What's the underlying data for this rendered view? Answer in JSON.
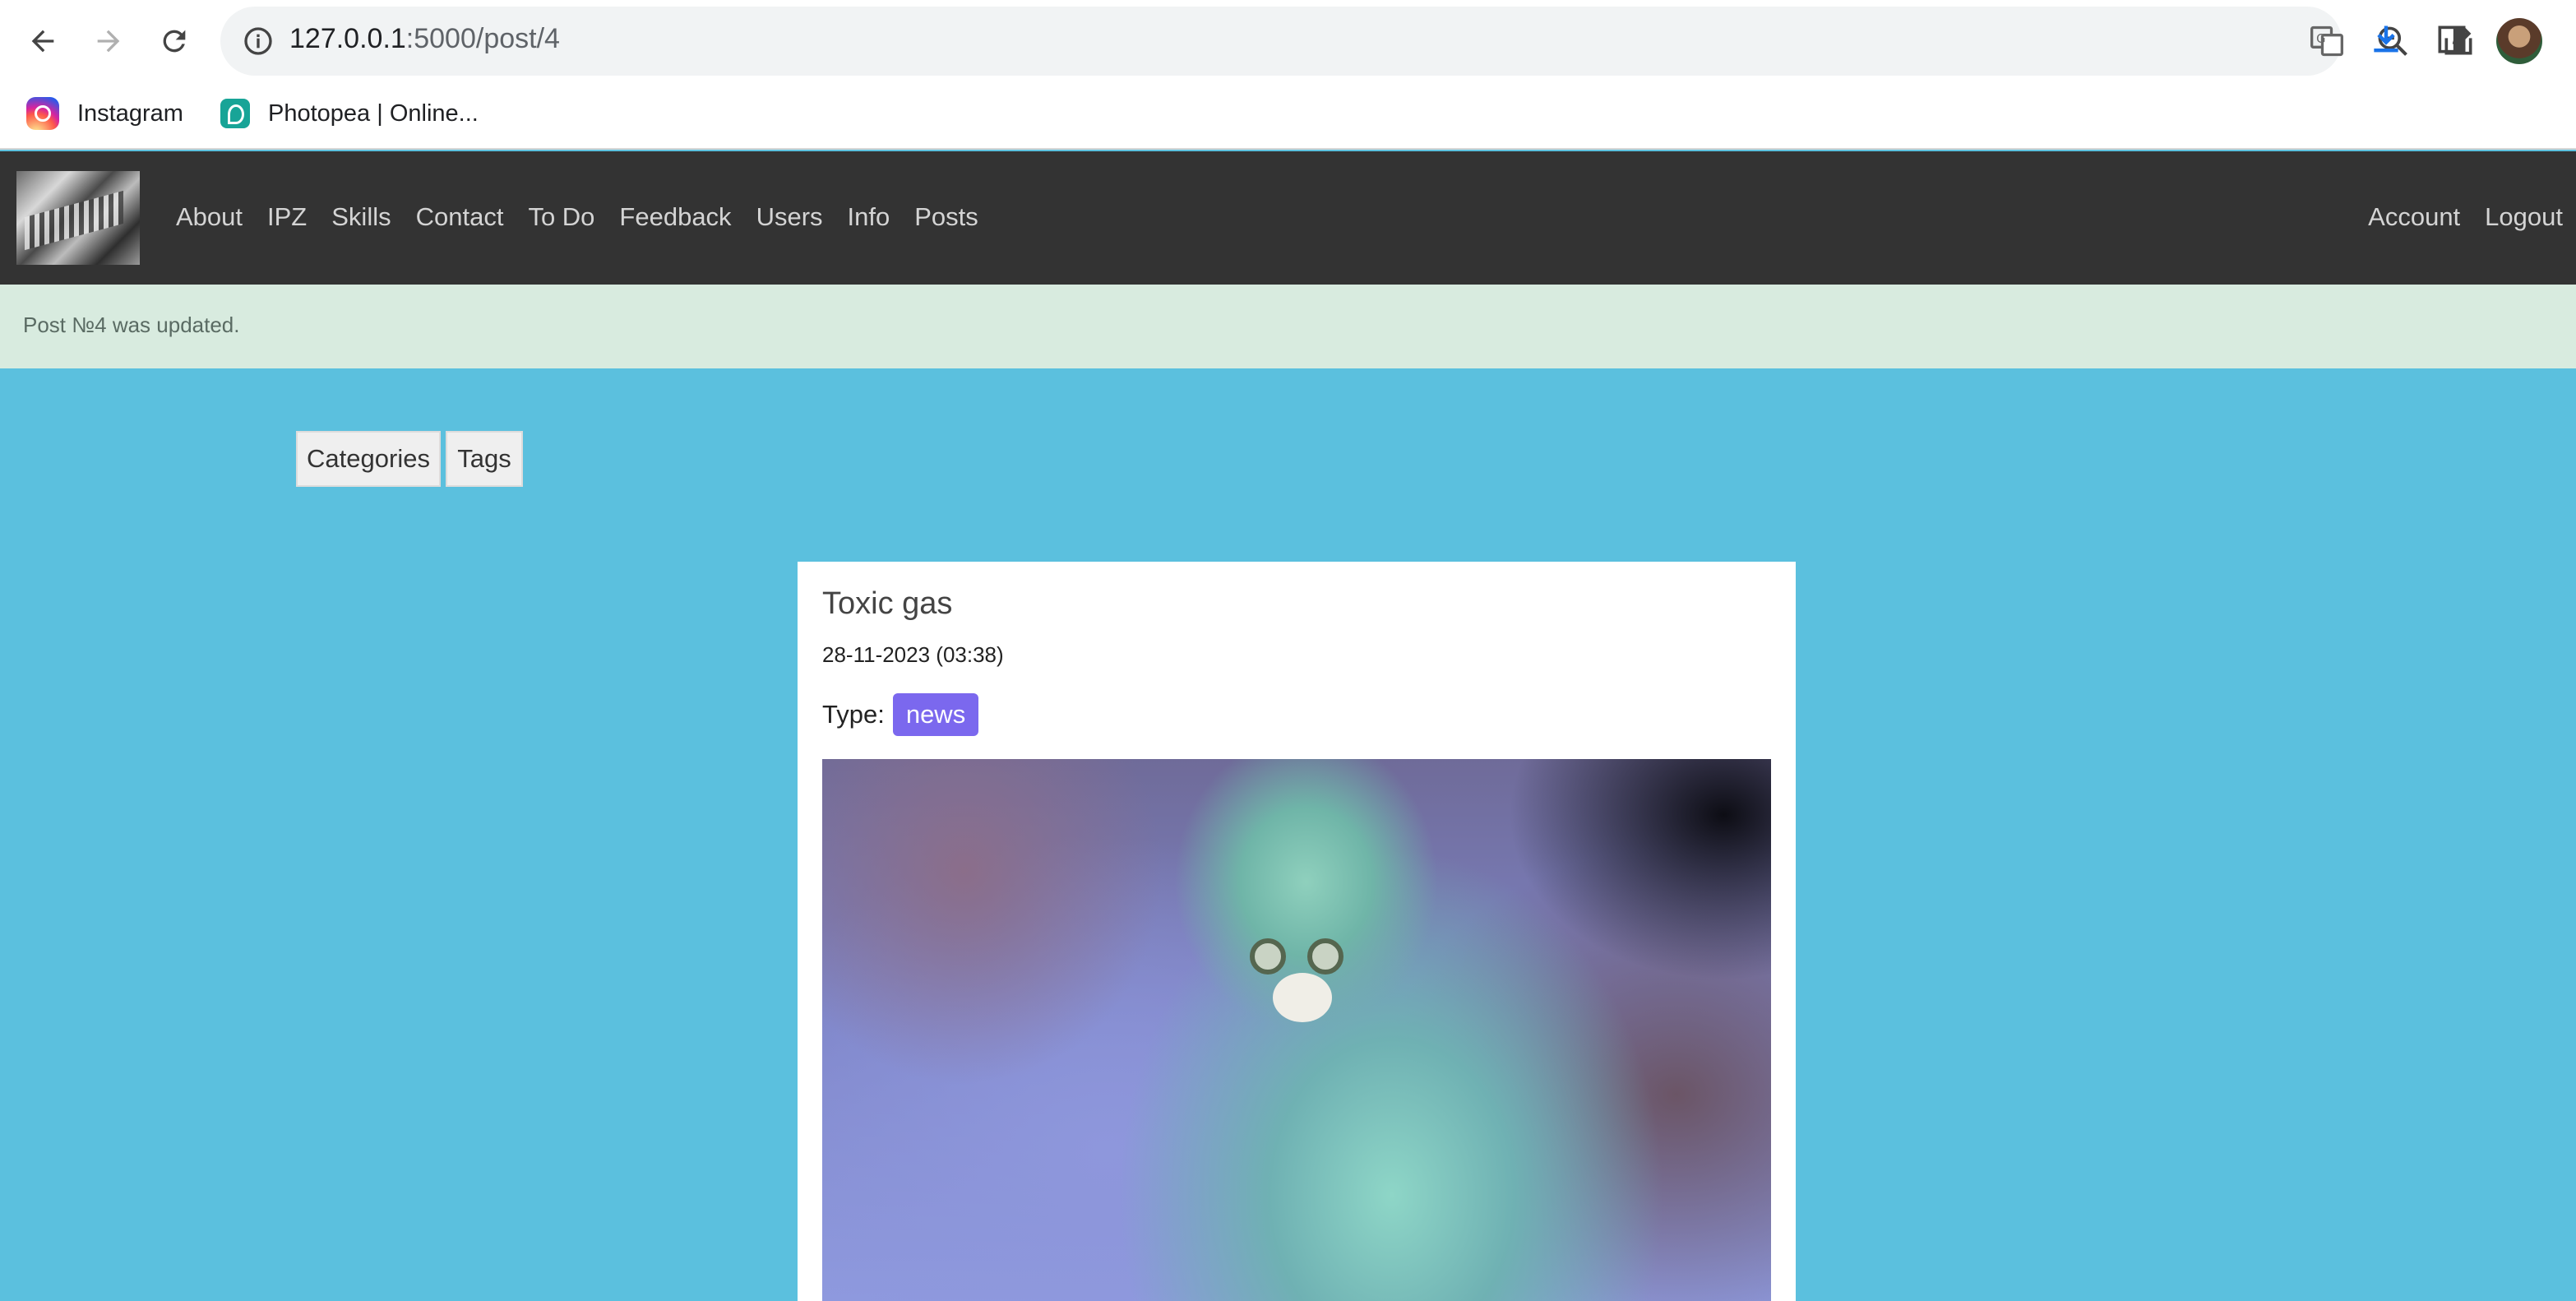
{
  "browser": {
    "url_host": "127.0.0.1",
    "url_path": ":5000/post/4",
    "bookmarks": [
      {
        "label": "Instagram",
        "icon": "instagram-icon"
      },
      {
        "label": "Photopea | Online...",
        "icon": "photopea-icon"
      }
    ]
  },
  "site": {
    "nav": [
      "About",
      "IPZ",
      "Skills",
      "Contact",
      "To Do",
      "Feedback",
      "Users",
      "Info",
      "Posts"
    ],
    "nav_right": [
      "Account",
      "Logout"
    ],
    "flash": "Post №4 was updated."
  },
  "filters": {
    "categories": "Categories",
    "tags": "Tags"
  },
  "post": {
    "title": "Toxic gas",
    "date": "28-11-2023 (03:38)",
    "type_label": "Type:",
    "type_badge": "news",
    "badge_color": "#7b68ee"
  },
  "colors": {
    "page_background": "#5bc0de",
    "navbar": "#333333",
    "flash_background": "#d8ebdf"
  }
}
